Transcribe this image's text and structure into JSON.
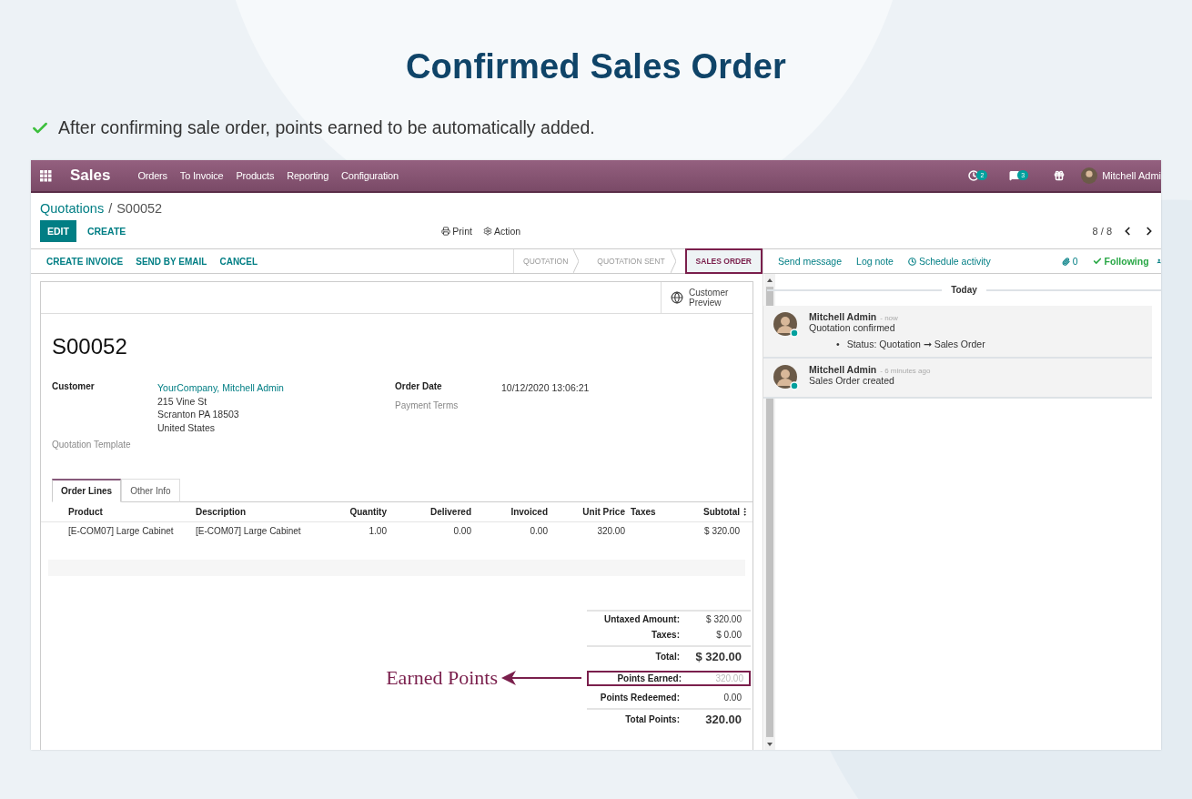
{
  "heading": "Confirmed Sales Order",
  "bullets": [
    {
      "text": "After confirming sale order, points earned to be automatically added.",
      "checked": true
    }
  ],
  "navbar": {
    "app_name": "Sales",
    "menu": [
      "Orders",
      "To Invoice",
      "Products",
      "Reporting",
      "Configuration"
    ],
    "activity_count": "2",
    "message_count": "3",
    "user": "Mitchell Admi"
  },
  "breadcrumb": {
    "parent": "Quotations",
    "separator": "/",
    "current": "S00052"
  },
  "control_panel": {
    "buttons": [
      {
        "label": "EDIT",
        "kind": "primary"
      },
      {
        "label": "CREATE",
        "kind": "link"
      }
    ],
    "print": "Print",
    "action": "Action",
    "pager": "8 / 8"
  },
  "header_buttons": [
    "CREATE INVOICE",
    "SEND BY EMAIL",
    "CANCEL"
  ],
  "stages": [
    {
      "label": "QUOTATION",
      "selected": false
    },
    {
      "label": "QUOTATION SENT",
      "selected": false
    },
    {
      "label": "SALES ORDER",
      "selected": true
    }
  ],
  "sheet": {
    "customer_preview": "Customer Preview",
    "name": "S00052",
    "left_fields": [
      {
        "label": "Customer",
        "link": "YourCompany, Mitchell Admin",
        "lines": [
          "215 Vine St",
          "Scranton PA 18503",
          "United States"
        ],
        "muted": false
      },
      {
        "label": "Quotation Template",
        "muted": true
      }
    ],
    "right_fields": [
      {
        "label": "Order Date",
        "value": "10/12/2020 13:06:21",
        "muted": false
      },
      {
        "label": "Payment Terms",
        "muted": true
      }
    ],
    "tabs": [
      {
        "label": "Order Lines",
        "selected": true
      },
      {
        "label": "Other Info",
        "selected": false
      }
    ],
    "table": {
      "columns": [
        "Product",
        "Description",
        "Quantity",
        "Delivered",
        "Invoiced",
        "Unit Price",
        "Taxes",
        "Subtotal"
      ],
      "rows": [
        [
          "[E-COM07] Large Cabinet",
          "[E-COM07] Large Cabinet",
          "1.00",
          "0.00",
          "0.00",
          "320.00",
          "",
          "$ 320.00"
        ]
      ]
    },
    "totals": [
      {
        "label": "Untaxed Amount:",
        "value": "$ 320.00",
        "kind": "normal",
        "divider_above": true
      },
      {
        "label": "Taxes:",
        "value": "$ 0.00",
        "kind": "normal",
        "divider_above": false
      },
      {
        "label": "Total:",
        "value": "$ 320.00",
        "kind": "grand",
        "divider_above": true
      },
      {
        "label": "Points Earned:",
        "value": "320.00",
        "kind": "boxed",
        "divider_above": false,
        "callout": "Earned Points"
      },
      {
        "label": "Points Redeemed:",
        "value": "0.00",
        "kind": "normal",
        "divider_above": false
      },
      {
        "label": "Total Points:",
        "value": "320.00",
        "kind": "grand",
        "divider_above": true
      }
    ]
  },
  "chatter": {
    "actions": [
      "Send message",
      "Log note",
      "Schedule activity"
    ],
    "attachments": "0",
    "follow": "Following",
    "date": "Today",
    "messages": [
      {
        "author": "Mitchell Admin",
        "time": "- now",
        "body": "Quotation confirmed",
        "changes": [
          {
            "bullet": "•",
            "text": "Status: Quotation ➞ Sales Order"
          }
        ]
      },
      {
        "author": "Mitchell Admin",
        "time": "- 6 minutes ago",
        "body": "Sales Order created"
      }
    ]
  }
}
